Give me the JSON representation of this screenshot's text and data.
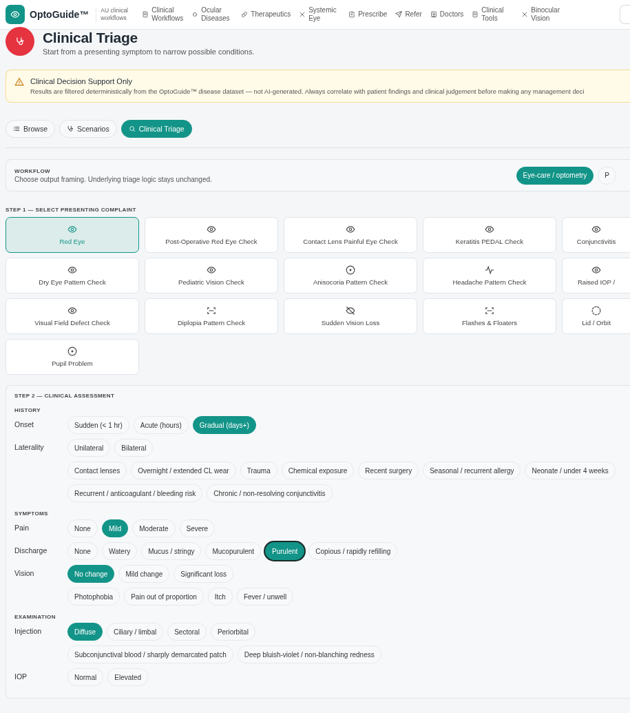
{
  "app": {
    "brand": "OptoGuide™",
    "tagline": "AU clinical workflows"
  },
  "nav": [
    {
      "label": "Clinical Workflows",
      "kind": "doc"
    },
    {
      "label": "Ocular Diseases",
      "kind": "dot"
    },
    {
      "label": "Therapeutics",
      "kind": "pill"
    },
    {
      "label": "Systemic Eye",
      "kind": "cross"
    },
    {
      "label": "Prescribe",
      "kind": "edit"
    },
    {
      "label": "Refer",
      "kind": "send"
    },
    {
      "label": "Doctors",
      "kind": "badge"
    },
    {
      "label": "Clinical Tools",
      "kind": "doc"
    },
    {
      "label": "Binocular Vision",
      "kind": "cross"
    }
  ],
  "header": {
    "title": "Clinical Triage",
    "subtitle": "Start from a presenting symptom to narrow possible conditions."
  },
  "alert": {
    "title": "Clinical Decision Support Only",
    "text": "Results are filtered deterministically from the OptoGuide™ disease dataset — not AI-generated. Always correlate with patient findings and clinical judgement before making any management deci"
  },
  "tabs": [
    {
      "label": "Browse",
      "kind": "list",
      "selected": false
    },
    {
      "label": "Scenarios",
      "kind": "steth",
      "selected": false
    },
    {
      "label": "Clinical Triage",
      "kind": "search",
      "selected": true
    }
  ],
  "workflow": {
    "heading": "WORKFLOW",
    "text": "Choose output framing. Underlying triage logic stays unchanged.",
    "options": [
      {
        "label": "Eye-care / optometry",
        "selected": true
      },
      {
        "label": "P",
        "selected": false
      }
    ]
  },
  "step1": {
    "heading": "STEP 1 — SELECT PRESENTING COMPLAINT",
    "complaints": [
      {
        "label": "Red Eye",
        "kind": "eye",
        "selected": true
      },
      {
        "label": "Post-Operative Red Eye Check",
        "kind": "eye",
        "selected": false
      },
      {
        "label": "Contact Lens Painful Eye Check",
        "kind": "eye",
        "selected": false
      },
      {
        "label": "Keratitis PEDAL Check",
        "kind": "eye",
        "selected": false
      },
      {
        "label": "Conjunctivitis",
        "kind": "eye",
        "selected": false
      },
      {
        "label": "Dry Eye Pattern Check",
        "kind": "eye",
        "selected": false
      },
      {
        "label": "Pediatric Vision Check",
        "kind": "eye",
        "selected": false
      },
      {
        "label": "Anisocoria Pattern Check",
        "kind": "target",
        "selected": false
      },
      {
        "label": "Headache Pattern Check",
        "kind": "pulse",
        "selected": false
      },
      {
        "label": "Raised IOP /",
        "kind": "eye",
        "selected": false
      },
      {
        "label": "Visual Field Defect Check",
        "kind": "eye",
        "selected": false
      },
      {
        "label": "Diplopia Pattern Check",
        "kind": "scan",
        "selected": false
      },
      {
        "label": "Sudden Vision Loss",
        "kind": "eyeoff",
        "selected": false
      },
      {
        "label": "Flashes & Floaters",
        "kind": "scan",
        "selected": false
      },
      {
        "label": "Lid / Orbit",
        "kind": "dashed",
        "selected": false
      },
      {
        "label": "Pupil Problem",
        "kind": "target",
        "selected": false
      }
    ]
  },
  "step2": {
    "heading": "STEP 2 — CLINICAL ASSESSMENT",
    "sections": [
      {
        "heading": "HISTORY",
        "rows": [
          {
            "label": "Onset",
            "options": [
              {
                "label": "Sudden (< 1 hr)",
                "selected": false
              },
              {
                "label": "Acute (hours)",
                "selected": false
              },
              {
                "label": "Gradual (days+)",
                "selected": true
              }
            ]
          },
          {
            "label": "Laterality",
            "options": [
              {
                "label": "Unilateral",
                "selected": false
              },
              {
                "label": "Bilateral",
                "selected": false
              }
            ]
          },
          {
            "options": [
              {
                "label": "Contact lenses",
                "selected": false
              },
              {
                "label": "Overnight / extended CL wear",
                "selected": false
              },
              {
                "label": "Trauma",
                "selected": false
              },
              {
                "label": "Chemical exposure",
                "selected": false
              },
              {
                "label": "Recent surgery",
                "selected": false
              },
              {
                "label": "Seasonal / recurrent allergy",
                "selected": false
              },
              {
                "label": "Neonate / under 4 weeks",
                "selected": false
              },
              {
                "label": "Recurrent / anticoagulant / bleeding risk",
                "selected": false
              },
              {
                "label": "Chronic / non-resolving conjunctivitis",
                "selected": false
              }
            ]
          }
        ]
      },
      {
        "heading": "SYMPTOMS",
        "rows": [
          {
            "label": "Pain",
            "options": [
              {
                "label": "None",
                "selected": false
              },
              {
                "label": "Mild",
                "selected": true
              },
              {
                "label": "Moderate",
                "selected": false
              },
              {
                "label": "Severe",
                "selected": false
              }
            ]
          },
          {
            "label": "Discharge",
            "options": [
              {
                "label": "None",
                "selected": false,
                "focused": false
              },
              {
                "label": "Watery",
                "selected": false,
                "focused": false
              },
              {
                "label": "Mucus / stringy",
                "selected": false,
                "focused": false
              },
              {
                "label": "Mucopurulent",
                "selected": false,
                "focused": false
              },
              {
                "label": "Purulent",
                "selected": true,
                "focused": true
              },
              {
                "label": "Copious / rapidly refilling",
                "selected": false,
                "focused": false
              }
            ]
          },
          {
            "label": "Vision",
            "options": [
              {
                "label": "No change",
                "selected": true
              },
              {
                "label": "Mild change",
                "selected": false
              },
              {
                "label": "Significant loss",
                "selected": false
              }
            ]
          },
          {
            "options": [
              {
                "label": "Photophobia",
                "selected": false
              },
              {
                "label": "Pain out of proportion",
                "selected": false
              },
              {
                "label": "Itch",
                "selected": false
              },
              {
                "label": "Fever / unwell",
                "selected": false
              }
            ]
          }
        ]
      },
      {
        "heading": "EXAMINATION",
        "rows": [
          {
            "label": "Injection",
            "options": [
              {
                "label": "Diffuse",
                "selected": true
              },
              {
                "label": "Ciliary / limbal",
                "selected": false
              },
              {
                "label": "Sectoral",
                "selected": false
              },
              {
                "label": "Periorbital",
                "selected": false
              }
            ]
          },
          {
            "options": [
              {
                "label": "Subconjunctival blood / sharply demarcated patch",
                "selected": false
              },
              {
                "label": "Deep bluish-violet / non-blanching redness",
                "selected": false
              }
            ]
          },
          {
            "label": "IOP",
            "options": [
              {
                "label": "Normal",
                "selected": false
              },
              {
                "label": "Elevated",
                "selected": false
              }
            ]
          }
        ]
      }
    ]
  }
}
